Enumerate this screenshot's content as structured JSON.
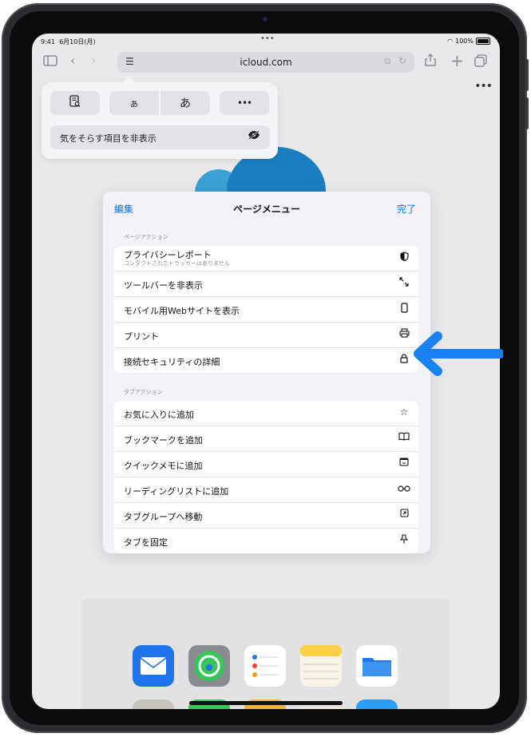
{
  "status_bar": {
    "time": "9:41",
    "date": "6月10日(月)",
    "multitask_dots": "•••",
    "battery_percent": "100%"
  },
  "toolbar": {
    "url_domain": "icloud.com",
    "more": "•••"
  },
  "format_popover": {
    "small_text": "あ",
    "large_text": "あ",
    "more": "•••",
    "hide_distracting": "気をそらす項目を非表示"
  },
  "page_menu": {
    "edit": "編集",
    "title": "ページメニュー",
    "done": "完了",
    "page_actions_header": "ページアクション",
    "page_actions": [
      {
        "label": "プライバシーレポート",
        "sublabel": "コンタクトされたトラッカーはありません",
        "icon": "shield-half-icon"
      },
      {
        "label": "ツールバーを非表示",
        "icon": "arrows-diagonal-icon"
      },
      {
        "label": "モバイル用Webサイトを表示",
        "icon": "iphone-icon"
      },
      {
        "label": "プリント",
        "icon": "printer-icon"
      },
      {
        "label": "接続セキュリティの詳細",
        "icon": "lock-icon"
      }
    ],
    "tab_actions_header": "タブアクション",
    "tab_actions": [
      {
        "label": "お気に入りに追加",
        "icon": "star-icon"
      },
      {
        "label": "ブックマークを追加",
        "icon": "book-icon"
      },
      {
        "label": "クイックメモに追加",
        "icon": "quick-note-icon"
      },
      {
        "label": "リーディングリストに追加",
        "icon": "glasses-icon"
      },
      {
        "label": "タブグループへ移動",
        "icon": "move-to-group-icon"
      },
      {
        "label": "タブを固定",
        "icon": "pin-icon"
      }
    ]
  },
  "colors": {
    "accent": "#0a72e0",
    "callout_arrow": "#1a82f0"
  }
}
